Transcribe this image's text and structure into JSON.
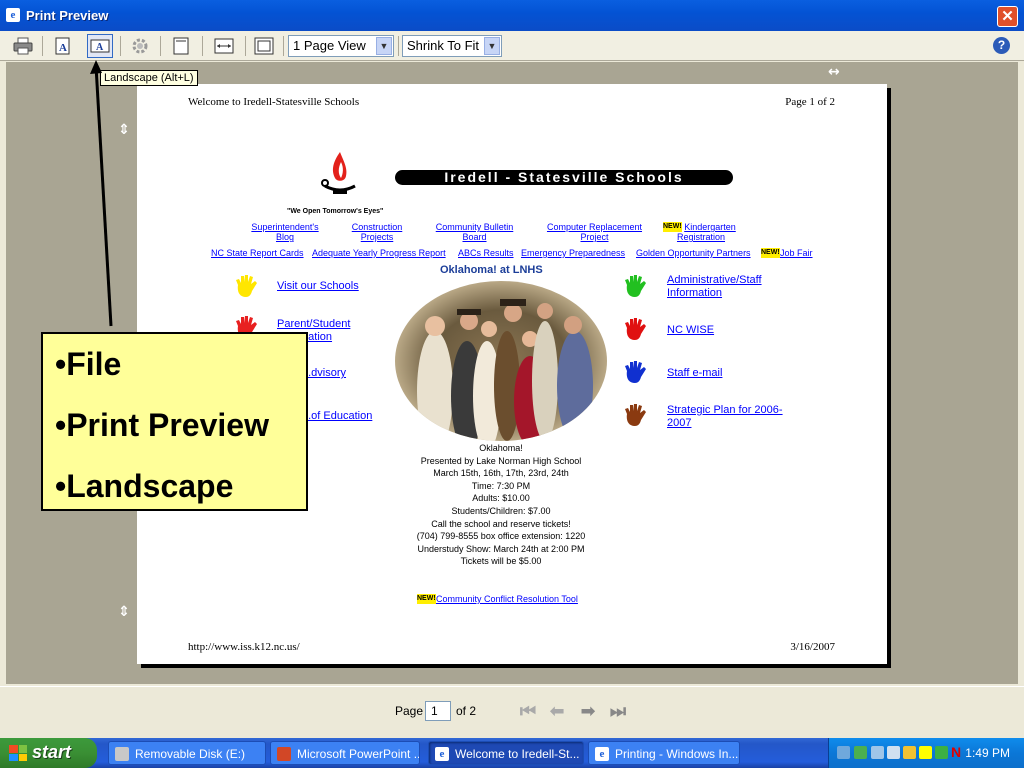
{
  "window": {
    "title": "Print Preview",
    "close": "✕"
  },
  "toolbar": {
    "view_select": "1 Page View",
    "fit_select": "Shrink To Fit",
    "help": "?"
  },
  "tooltip": "Landscape (Alt+L)",
  "page": {
    "header_left": "Welcome to Iredell-Statesville Schools",
    "header_right": "Page 1 of 2",
    "footer_left": "http://www.iss.k12.nc.us/",
    "footer_right": "3/16/2007",
    "banner": "Iredell - Statesville Schools",
    "motto": "\"We Open Tomorrow's Eyes\"",
    "nav_row1": [
      "Superintendent's Blog",
      "Construction Projects",
      "Community Bulletin Board",
      "Computer Replacement Project",
      "Kindergarten Registration"
    ],
    "nav_row2": [
      "NC State Report Cards",
      "Adequate Yearly Progress Report",
      "ABCs Results",
      "Emergency Preparedness",
      "Golden Opportunity Partners",
      "Job Fair"
    ],
    "new_badge": "NEW!",
    "oklahoma_title": "Oklahoma! at LNHS",
    "left_links": [
      "Visit our Schools",
      "Parent/Student Information",
      "...dvisory",
      "...of Education"
    ],
    "right_links": [
      "Administrative/Staff Information",
      "NC WISE",
      "Staff e-mail",
      "Strategic Plan for 2006-2007"
    ],
    "info_lines": [
      "Oklahoma!",
      "Presented by Lake Norman High School",
      "March 15th, 16th, 17th, 23rd, 24th",
      "Time: 7:30 PM",
      "Adults:  $10.00",
      "Students/Children:  $7.00",
      "Call the school and reserve tickets!",
      "(704) 799-8555 box office extension: 1220",
      "Understudy Show:  March 24th at 2:00 PM",
      "Tickets will be $5.00"
    ],
    "conflict_link": "Community Conflict Resolution Tool"
  },
  "bullets": [
    "•File",
    "•Print Preview",
    "•Landscape"
  ],
  "statusbar": {
    "page_label": "Page",
    "page_value": "1",
    "of_label": "of 2"
  },
  "taskbar": {
    "start": "start",
    "tasks": [
      "Removable Disk (E:)",
      "Microsoft PowerPoint ...",
      "Welcome to Iredell-St...",
      "Printing - Windows In..."
    ],
    "clock": "1:49 PM"
  },
  "colors": {
    "accent": "#0A5FE0",
    "callout": "#FFFF99",
    "link": "#0000FF"
  },
  "hand_colors": {
    "left": [
      "#FFE600",
      "#E82020"
    ],
    "right": [
      "#22C020",
      "#E01010",
      "#1030D0",
      "#8A3A10"
    ]
  }
}
